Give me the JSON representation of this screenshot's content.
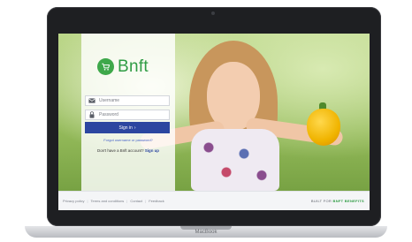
{
  "device": {
    "base_label": "MacBook"
  },
  "app": {
    "logo_text": "Bnft",
    "accent_color": "#2f9c44",
    "button_color": "#2c46a0"
  },
  "login": {
    "username_placeholder": "Username",
    "password_placeholder": "Password",
    "signin_label": "Sign in",
    "forgot_link": "Forgot username or password?",
    "enroll_prompt": "Don't have a Bnft account?",
    "enroll_link": "Sign up"
  },
  "footer": {
    "links": [
      "Privacy policy",
      "Terms and conditions",
      "Contact",
      "Feedback"
    ],
    "right_prefix": "BUILT FOR",
    "right_brand": "BNFT BENEFITS"
  },
  "icons": {
    "logo": "cart-icon",
    "username": "envelope-icon",
    "password": "lock-icon",
    "signin": "chevron-right-icon"
  }
}
